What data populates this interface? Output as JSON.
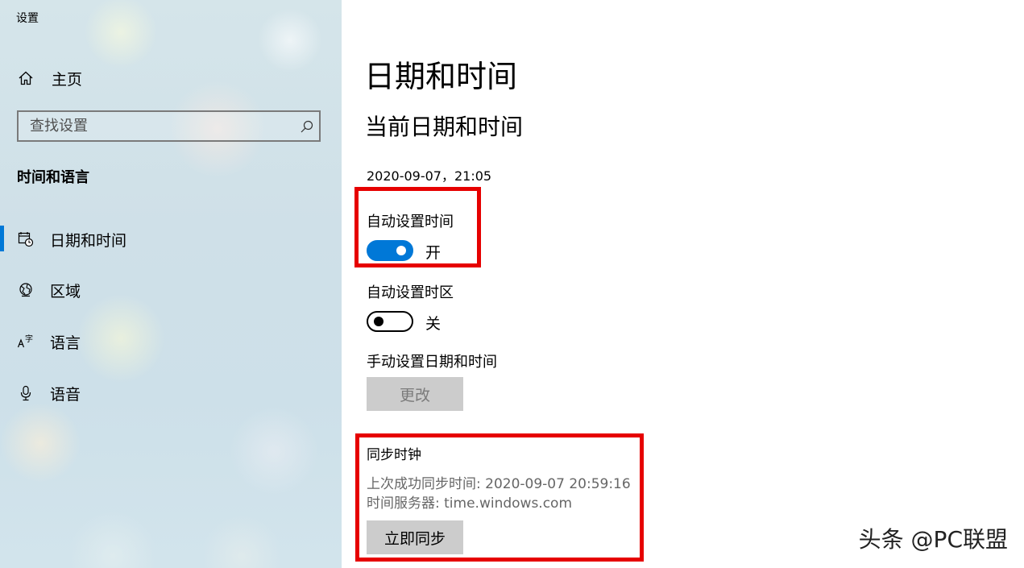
{
  "app": {
    "title": "设置"
  },
  "sidebar": {
    "home_label": "主页",
    "search_placeholder": "查找设置",
    "section_heading": "时间和语言",
    "items": [
      {
        "label": "日期和时间",
        "icon": "calendar-clock-icon",
        "selected": true
      },
      {
        "label": "区域",
        "icon": "globe-region-icon",
        "selected": false
      },
      {
        "label": "语言",
        "icon": "language-icon",
        "selected": false
      },
      {
        "label": "语音",
        "icon": "microphone-icon",
        "selected": false
      }
    ]
  },
  "main": {
    "title": "日期和时间",
    "subheading": "当前日期和时间",
    "current_datetime": "2020-09-07，21:05",
    "auto_time": {
      "label": "自动设置时间",
      "state": "开",
      "on": true
    },
    "auto_timezone": {
      "label": "自动设置时区",
      "state": "关",
      "on": false
    },
    "manual": {
      "label": "手动设置日期和时间",
      "button": "更改"
    },
    "sync": {
      "heading": "同步时钟",
      "last_sync": "上次成功同步时间: 2020-09-07 20:59:16",
      "time_server": "时间服务器: time.windows.com",
      "button": "立即同步"
    }
  },
  "watermark": "头条 @PC联盟",
  "colors": {
    "accent": "#0078d7",
    "highlight": "#e60000"
  }
}
